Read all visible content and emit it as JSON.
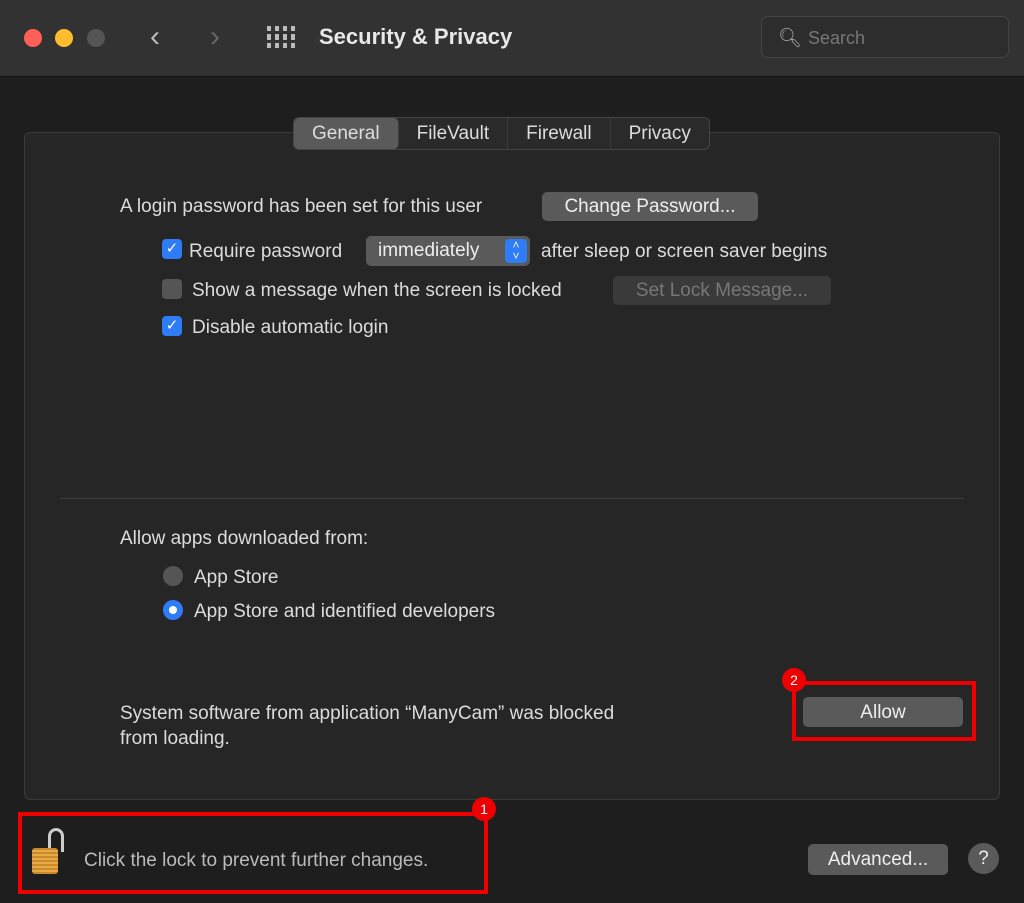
{
  "window": {
    "title": "Security & Privacy",
    "search_placeholder": "Search"
  },
  "tabs": [
    {
      "label": "General",
      "active": true
    },
    {
      "label": "FileVault"
    },
    {
      "label": "Firewall"
    },
    {
      "label": "Privacy"
    }
  ],
  "general": {
    "login_text": "A login password has been set for this user",
    "change_password": "Change Password...",
    "require_password": {
      "label": "Require password",
      "checked": true,
      "select_value": "immediately",
      "suffix": "after sleep or screen saver begins"
    },
    "show_message": {
      "label": "Show a message when the screen is locked",
      "checked": false,
      "button": "Set Lock Message..."
    },
    "disable_autologin": {
      "label": "Disable automatic login",
      "checked": true
    },
    "allow_apps_label": "Allow apps downloaded from:",
    "radio_options": [
      {
        "label": "App Store",
        "selected": false
      },
      {
        "label": "App Store and identified developers",
        "selected": true
      }
    ],
    "blocked_text_line1": "System software from application “ManyCam” was blocked",
    "blocked_text_line2": "from loading.",
    "allow_button": "Allow"
  },
  "footer": {
    "lock_text": "Click the lock to prevent further changes.",
    "advanced": "Advanced...",
    "help": "?"
  },
  "annotations": {
    "badge1": "1",
    "badge2": "2"
  },
  "colors": {
    "accent": "#2e7cf6",
    "highlight": "#e00000"
  }
}
